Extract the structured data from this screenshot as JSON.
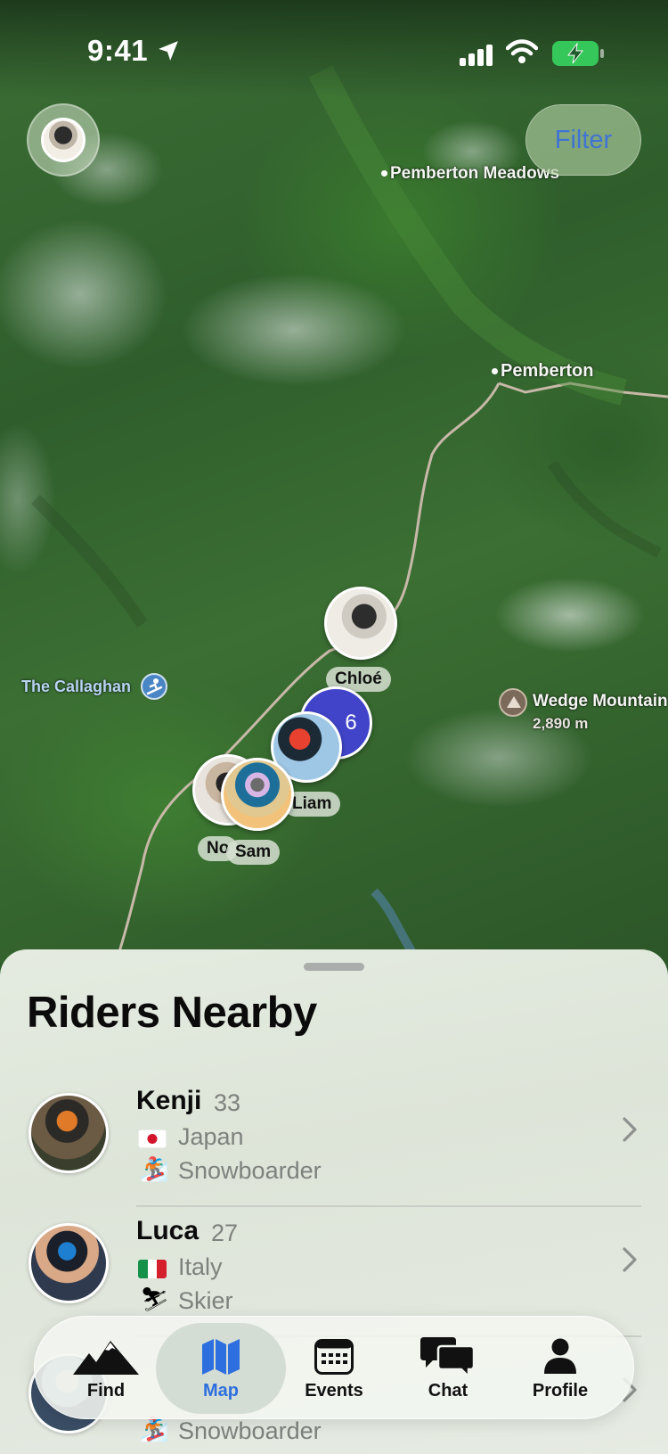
{
  "status_bar": {
    "time": "9:41"
  },
  "header": {
    "filter_label": "Filter"
  },
  "map": {
    "places": {
      "pemberton_meadows": "Pemberton Meadows",
      "pemberton": "Pemberton",
      "callaghan": "The Callaghan",
      "wedge_mountain": "Wedge Mountain",
      "wedge_elevation": "2,890 m"
    },
    "pins": {
      "chloe": "Chloé",
      "cluster_count": "6",
      "liam": "Liam",
      "no": "No",
      "sam": "Sam"
    }
  },
  "sheet": {
    "title": "Riders Nearby",
    "riders": [
      {
        "name": "Kenji",
        "age": "33",
        "country": "Japan",
        "flag": "japan-flag",
        "sport": "Snowboarder",
        "sport_icon": "snowboarder-icon"
      },
      {
        "name": "Luca",
        "age": "27",
        "country": "Italy",
        "flag": "italy-flag",
        "sport": "Skier",
        "sport_icon": "skier-icon"
      },
      {
        "name": "",
        "age": "",
        "country": "",
        "flag": "",
        "sport": "Snowboarder",
        "sport_icon": "snowboarder-icon"
      }
    ]
  },
  "tabbar": {
    "tabs": [
      {
        "label": "Find",
        "icon": "mountains-icon"
      },
      {
        "label": "Map",
        "icon": "map-icon",
        "active": true
      },
      {
        "label": "Events",
        "icon": "calendar-icon"
      },
      {
        "label": "Chat",
        "icon": "chat-bubbles-icon"
      },
      {
        "label": "Profile",
        "icon": "person-icon"
      }
    ]
  },
  "colors": {
    "accent": "#2d6fde",
    "battery": "#35c759",
    "cluster": "#4144c9"
  }
}
